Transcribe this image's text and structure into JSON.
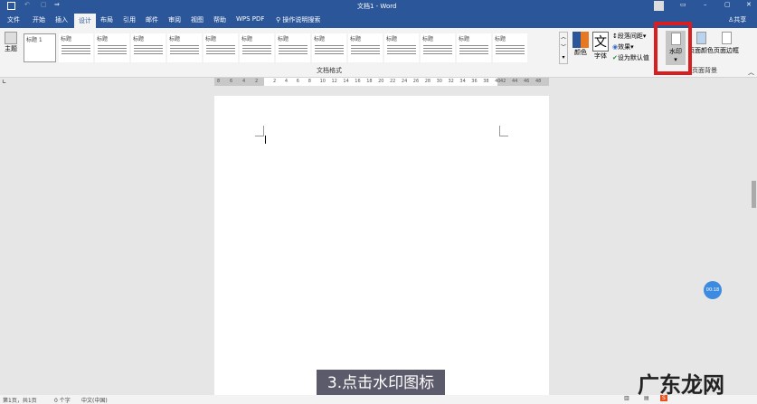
{
  "title": "文档1 - Word",
  "quick_access": [
    "save-icon",
    "undo-icon",
    "redo-icon",
    "customize-icon"
  ],
  "tabs": [
    "文件",
    "开始",
    "插入",
    "设计",
    "布局",
    "引用",
    "邮件",
    "审阅",
    "视图",
    "帮助",
    "WPS PDF"
  ],
  "active_tab": "设计",
  "tell_me": "操作说明搜索",
  "share": "共享",
  "ribbon": {
    "theme_label": "主题",
    "styles": [
      "标题 1",
      "标题",
      "标题",
      "标题",
      "标题",
      "标题",
      "标题",
      "标题",
      "标题",
      "标题",
      "标题",
      "标题",
      "标题",
      "标题"
    ],
    "group_document_format": "文档格式",
    "colors": "颜色",
    "fonts": "字体",
    "paragraph_spacing": "段落间距",
    "effects": "效果",
    "set_default": "设为默认值",
    "watermark": "水印",
    "page_color": "页面颜色",
    "page_borders": "页面边框",
    "group_page_background": "页面背景"
  },
  "ruler_left": [
    "8",
    "6",
    "4",
    "2"
  ],
  "ruler_main": [
    "2",
    "4",
    "6",
    "8",
    "10",
    "12",
    "14",
    "16",
    "18",
    "20",
    "22",
    "24",
    "26",
    "28",
    "30",
    "32",
    "34",
    "36",
    "38",
    "40"
  ],
  "ruler_right": [
    "42",
    "44",
    "46",
    "48"
  ],
  "status": {
    "page": "第1页，共1页",
    "words": "0 个字",
    "language": "中文(中国)"
  },
  "caption": "3.点击水印图标",
  "timer": "00:18",
  "watermark_text": "广东龙网",
  "colors": {
    "accent": "#2b579a",
    "highlight": "#d81e1e"
  }
}
